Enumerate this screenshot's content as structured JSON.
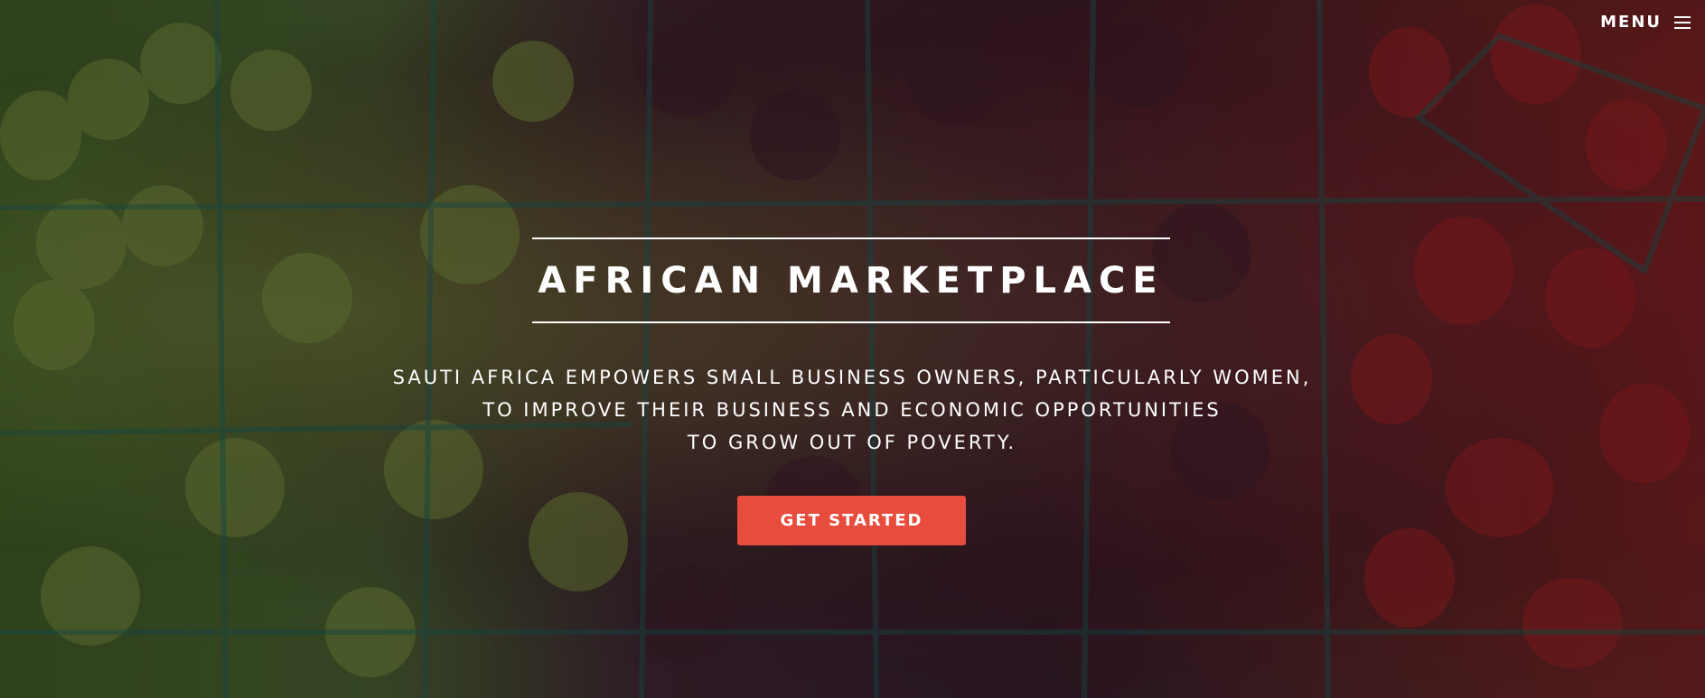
{
  "menu": {
    "label": "MENU",
    "icon": "hamburger-menu-icon"
  },
  "hero": {
    "background_image": "fruit-market-background",
    "title": "AFRICAN MARKETPLACE",
    "subtitle_lines": [
      "SAUTI AFRICA EMPOWERS SMALL BUSINESS OWNERS, PARTICULARLY WOMEN,",
      "TO IMPROVE THEIR BUSINESS AND ECONOMIC OPPORTUNITIES",
      "TO GROW OUT OF POVERTY."
    ],
    "cta_label": "GET STARTED"
  },
  "colors": {
    "accent": "#e84c3d",
    "text": "#ffffff"
  }
}
